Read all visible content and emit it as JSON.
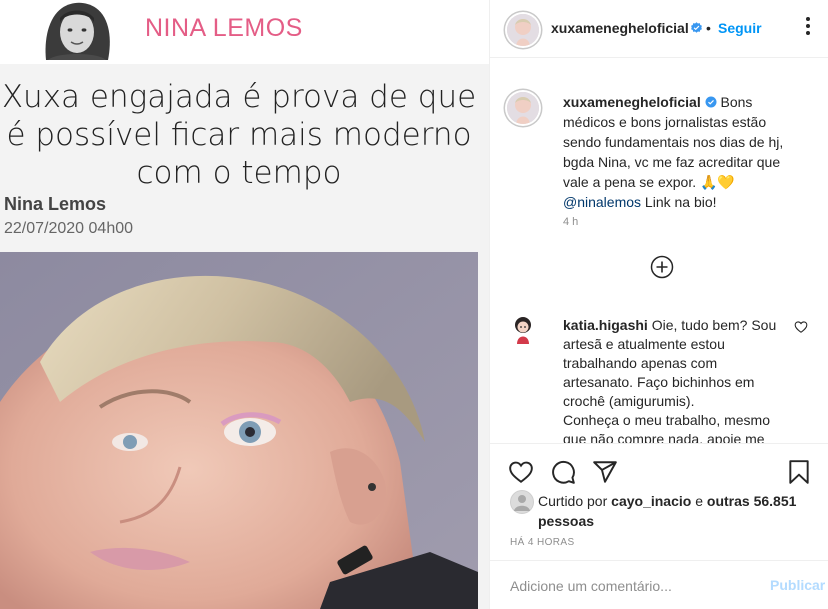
{
  "article": {
    "author_name": "NINA LEMOS",
    "headline_lines": [
      "Xuxa engajada é prova de que",
      "é possível ficar mais moderno",
      "com o tempo"
    ],
    "byline": "Nina Lemos",
    "date": "22/07/2020  04h00"
  },
  "post": {
    "username": "xuxamenegheloficial",
    "follow_separator": "•",
    "follow_label": "Seguir",
    "caption": {
      "username": "xuxamenegheloficial",
      "text": "Bons médicos e bons jornalistas estão sendo fundamentais nos dias de hj, bgda Nina, vc me faz acreditar que vale a pena se expor. ",
      "emojis": "🙏💛",
      "mention": "@ninalemos",
      "text_after": " Link na bio!",
      "time": "4 h"
    },
    "comment": {
      "username": "katia.higashi",
      "text": "Oie, tudo bem? Sou artesã e atualmente estou trabalhando apenas com artesanato. Faço bichinhos em crochê (amigurumis).",
      "text_line2": "Conheça o meu trabalho, mesmo que não compre nada, apoie me"
    },
    "likes": {
      "prefix": "Curtido por",
      "user": "cayo_inacio",
      "and": "e",
      "others": "outras 56.851 pessoas"
    },
    "age": "HÁ 4 HORAS",
    "comment_input": {
      "placeholder": "Adicione um comentário..."
    },
    "publish_label": "Publicar"
  },
  "icons": {
    "verified": "verified-badge-icon",
    "more": "more-options-icon",
    "load_more": "plus-circle-icon",
    "like": "heart-icon",
    "comment": "comment-bubble-icon",
    "share": "paper-plane-icon",
    "save": "bookmark-icon"
  },
  "colors": {
    "accent": "#0095f6",
    "article_name": "#e45d86",
    "verified": "#3897f0",
    "publish_disabled": "#b3dbff"
  }
}
